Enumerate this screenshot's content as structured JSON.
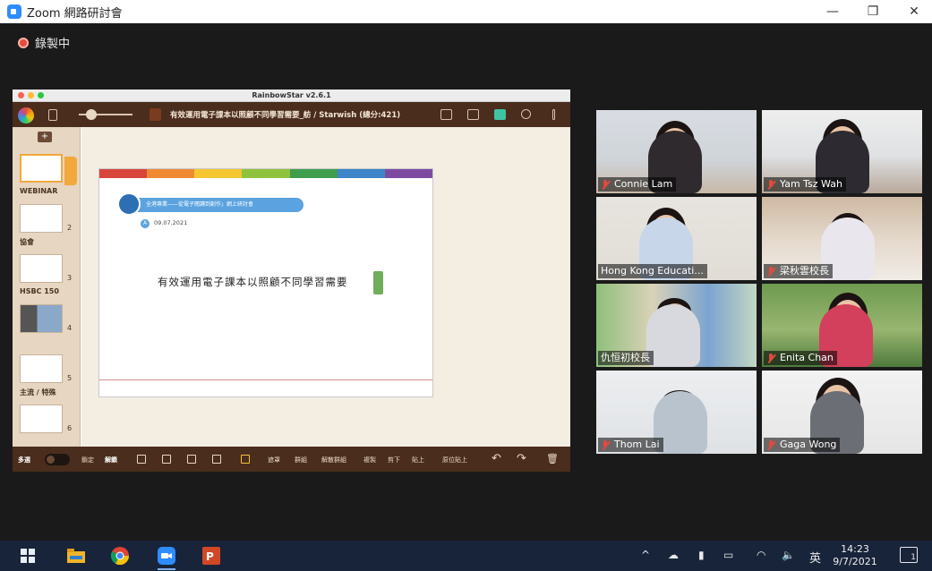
{
  "window": {
    "title": "Zoom 網路研討會",
    "minimize_glyph": "—",
    "maximize_glyph": "❐",
    "close_glyph": "✕"
  },
  "recording": {
    "label": "錄製中"
  },
  "shared_app": {
    "app_title": "RainbowStar v2.6.1",
    "document_title": "有效運用電子課本以照顧不同學習需要_舫 / Starwish (總分:421)",
    "add_glyph": "+",
    "thumbnails": [
      {
        "num": "",
        "label": "WEBINAR"
      },
      {
        "num": "2",
        "label": "協會"
      },
      {
        "num": "3",
        "label": "HSBC 150"
      },
      {
        "num": "4",
        "label": ""
      },
      {
        "num": "5",
        "label": "主流 / 特殊"
      },
      {
        "num": "6",
        "label": ""
      }
    ],
    "slide": {
      "pill_text": "全港專業——從電子閱讀到創作」網上研討會",
      "date_badge": "A",
      "date": "09.07.2021",
      "title": "有效運用電子課本以照顧不同學習需要"
    },
    "bottom_toolbar": {
      "multi_select": "多選",
      "lock": "鎖定",
      "unlock": "解鎖",
      "labels": [
        "遮罩",
        "群組",
        "解散群組",
        "複製",
        "剪下",
        "貼上",
        "原位貼上"
      ]
    }
  },
  "participants": [
    {
      "name": "Connie Lam",
      "muted": true
    },
    {
      "name": "Yam Tsz Wah",
      "muted": true
    },
    {
      "name": "Hong Kong Educati...",
      "muted": false
    },
    {
      "name": "梁秋雲校長",
      "muted": true
    },
    {
      "name": "仇恒初校長",
      "muted": false,
      "active": true
    },
    {
      "name": "Enita Chan",
      "muted": true
    },
    {
      "name": "Thom Lai",
      "muted": true
    },
    {
      "name": "Gaga Wong",
      "muted": true
    }
  ],
  "taskbar": {
    "ime": "英",
    "time": "14:23",
    "date": "9/7/2021",
    "notification_count": "1"
  },
  "colors": {
    "zoom_blue": "#2d8cff",
    "rainbowstar_brown": "#4a2d1d",
    "active_speaker": "#c9d94a",
    "muted_red": "#e24a3d"
  }
}
